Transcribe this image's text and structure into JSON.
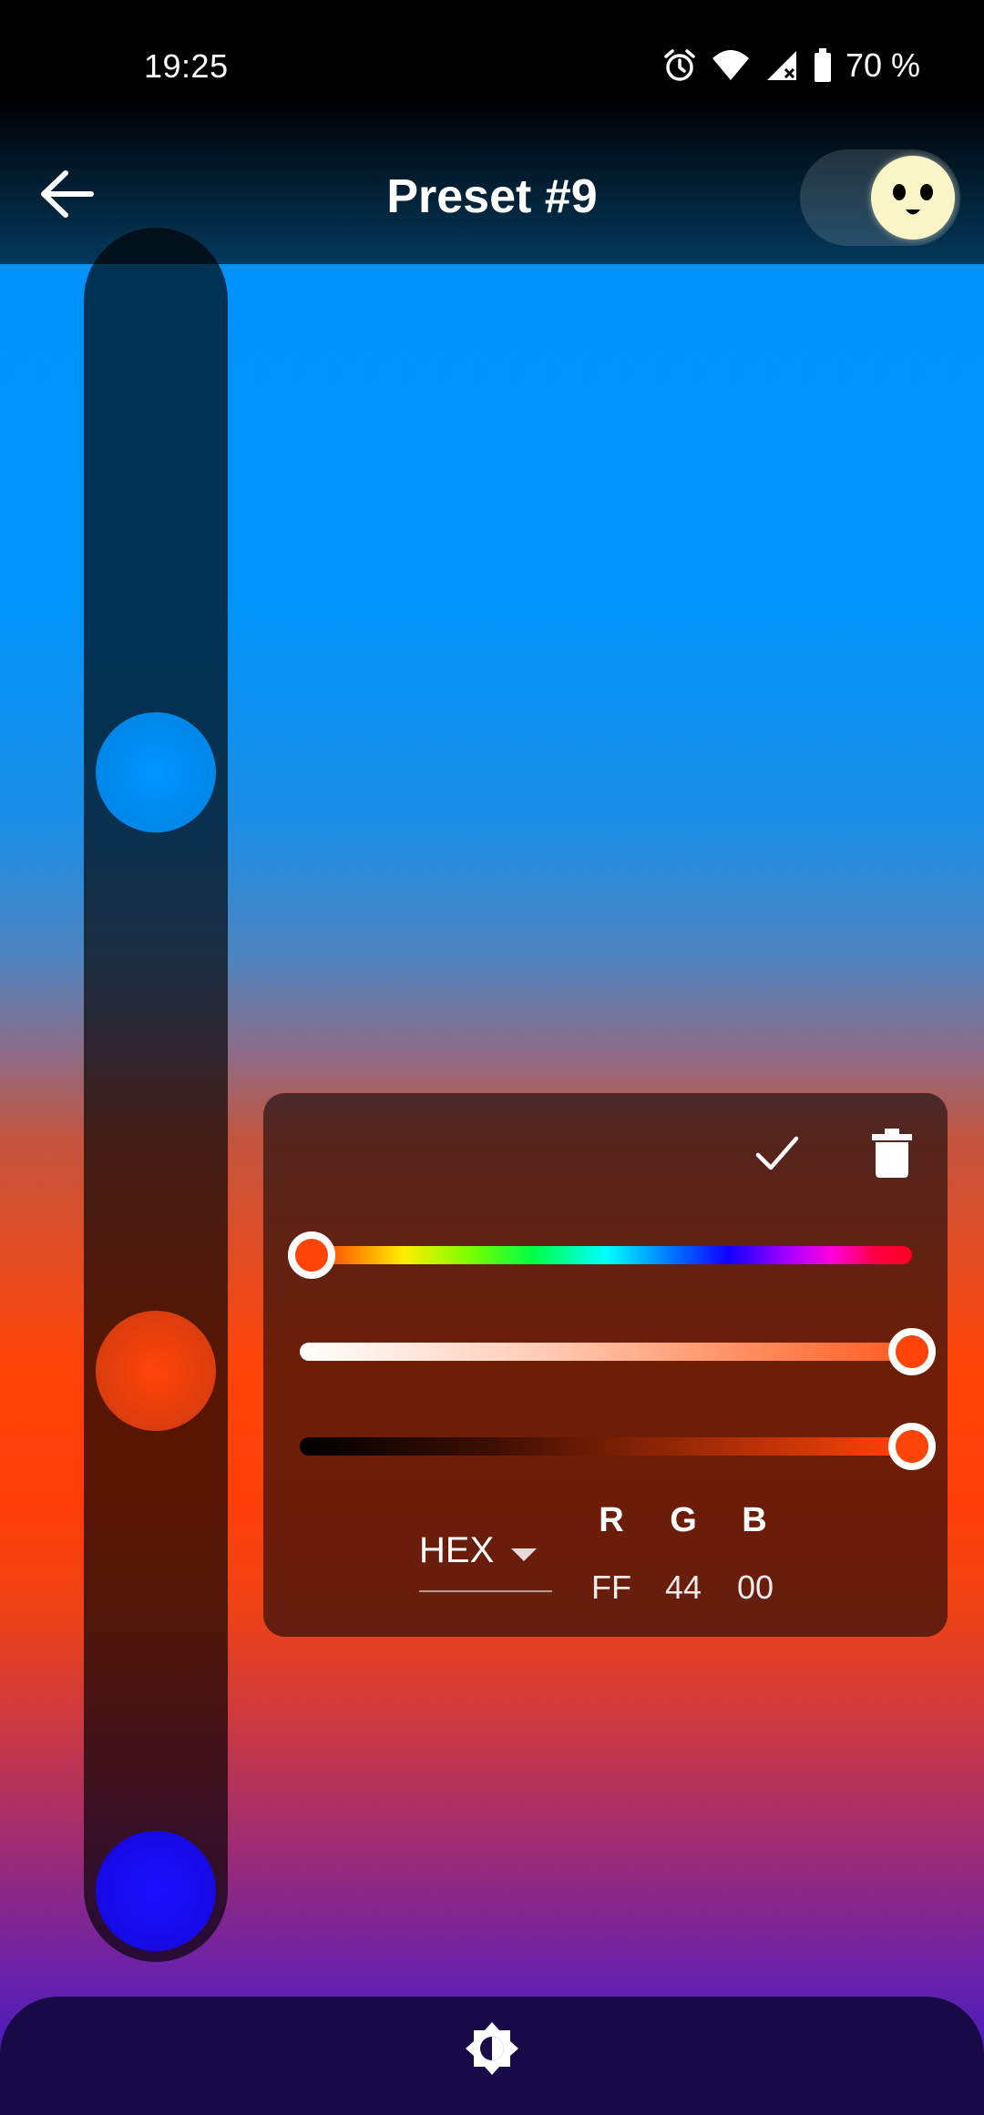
{
  "status_bar": {
    "time": "19:25",
    "battery": "70 %",
    "icons": [
      "alarm-icon",
      "wifi-icon",
      "signal-icon",
      "battery-icon"
    ]
  },
  "header": {
    "title": "Preset #9",
    "back_icon": "arrow-left-icon",
    "toggle_icon": "smiley-face-icon"
  },
  "gradient_stops": [
    {
      "color": "#0091ff"
    },
    {
      "color": "#ff4408"
    },
    {
      "color": "#1a10ff"
    }
  ],
  "picker": {
    "confirm_icon": "check-icon",
    "delete_icon": "trash-icon",
    "hue_fraction": 0.02,
    "saturation_fraction": 1.0,
    "value_fraction": 1.0,
    "selected_color": "#ff4408",
    "mode": "HEX",
    "channels": [
      {
        "label": "R",
        "value": "FF"
      },
      {
        "label": "G",
        "value": "44"
      },
      {
        "label": "B",
        "value": "00"
      }
    ]
  },
  "bottom_bar": {
    "icon": "brightness-icon"
  }
}
